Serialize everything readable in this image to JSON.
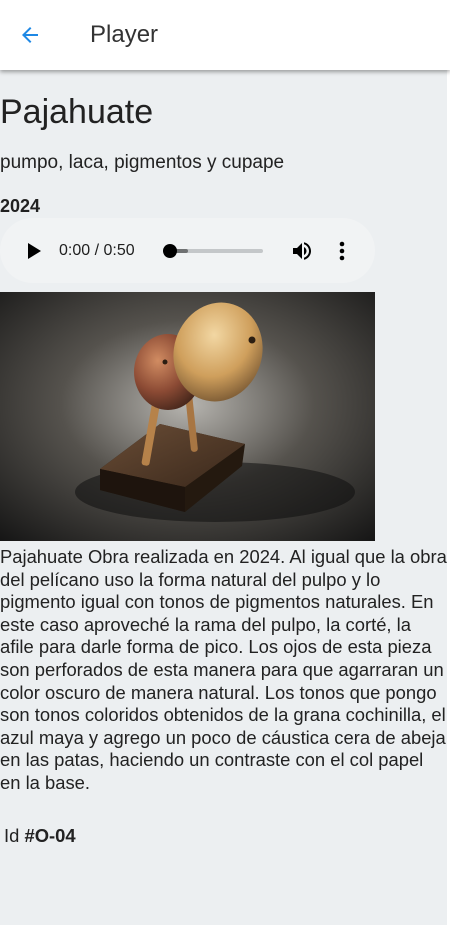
{
  "appbar": {
    "title": "Player",
    "back_icon": "arrow-left-icon",
    "accent_color": "#1e88e5"
  },
  "artwork": {
    "title": "Pajahuate",
    "materials": "pumpo, laca, pigmentos y cupape",
    "year": "2024",
    "description": "Pajahuate Obra realizada en 2024. Al igual que la obra del pelícano uso la forma natural del pulpo y lo pigmento igual con tonos de pigmentos naturales. En este caso aproveché la rama del pulpo, la corté, la afile para darle forma de pico. Los ojos de esta pieza son perforados de esta manera para que agarraran un color oscuro de manera natural. Los tonos que pongo son tonos coloridos obtenidos de la grana cochinilla, el azul maya y agrego un poco de cáustica cera de abeja en las patas, haciendo un contraste con el col papel en la base.",
    "id_label": "Id",
    "id_value": "#O-04"
  },
  "audio_player": {
    "time": "0:00 / 0:50",
    "progress_fraction": 0,
    "buffered_fraction": 0.25,
    "icons": [
      "play-icon",
      "volume-icon",
      "more-vertical-icon"
    ]
  },
  "colors": {
    "page_background": "#eceff1",
    "appbar_background": "#ffffff",
    "player_background": "#f1f3f4"
  }
}
